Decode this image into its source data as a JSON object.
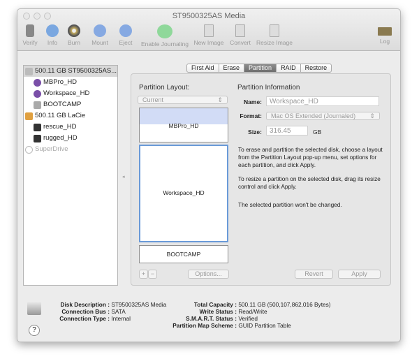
{
  "window": {
    "title": "ST9500325AS Media"
  },
  "toolbar": [
    {
      "label": "Verify",
      "icon": "microscope-icon"
    },
    {
      "label": "Info",
      "icon": "info-icon"
    },
    {
      "label": "Burn",
      "icon": "burn-icon"
    },
    {
      "label": "Mount",
      "icon": "mount-icon"
    },
    {
      "label": "Eject",
      "icon": "eject-icon"
    },
    {
      "label": "Enable Journaling",
      "icon": "journaling-icon"
    },
    {
      "label": "New Image",
      "icon": "new-image-icon"
    },
    {
      "label": "Convert",
      "icon": "convert-icon"
    },
    {
      "label": "Resize Image",
      "icon": "resize-image-icon"
    },
    {
      "label": "Log",
      "icon": "log-icon"
    }
  ],
  "sidebar": [
    {
      "label": "500.11 GB ST9500325AS...",
      "level": 0,
      "selected": true
    },
    {
      "label": "MBPro_HD",
      "level": 1
    },
    {
      "label": "Workspace_HD",
      "level": 1
    },
    {
      "label": "BOOTCAMP",
      "level": 1
    },
    {
      "label": "500.11 GB LaCie",
      "level": 0
    },
    {
      "label": "rescue_HD",
      "level": 1
    },
    {
      "label": "rugged_HD",
      "level": 1
    },
    {
      "label": "SuperDrive",
      "level": 0,
      "disabled": true
    }
  ],
  "tabs": [
    {
      "label": "First Aid"
    },
    {
      "label": "Erase"
    },
    {
      "label": "Partition",
      "active": true
    },
    {
      "label": "RAID"
    },
    {
      "label": "Restore"
    }
  ],
  "layout": {
    "heading": "Partition Layout:",
    "popup": "Current",
    "partitions": [
      "MBPro_HD",
      "Workspace_HD",
      "BOOTCAMP"
    ],
    "add": "+",
    "remove": "−",
    "options": "Options..."
  },
  "info": {
    "heading": "Partition Information",
    "name_label": "Name:",
    "name": "Workspace_HD",
    "format_label": "Format:",
    "format": "Mac OS Extended (Journaled)",
    "size_label": "Size:",
    "size": "316.45",
    "size_unit": "GB",
    "desc1": "To erase and partition the selected disk, choose a layout from the Partition Layout pop-up menu, set options for each partition, and click Apply.",
    "desc2": "To resize a partition on the selected disk, drag its resize control and click Apply.",
    "desc3": "The selected partition won't be changed.",
    "revert": "Revert",
    "apply": "Apply"
  },
  "details": {
    "left": [
      {
        "k": "Disk Description :",
        "v": "ST9500325AS Media"
      },
      {
        "k": "Connection Bus :",
        "v": "SATA"
      },
      {
        "k": "Connection Type :",
        "v": "Internal"
      }
    ],
    "right": [
      {
        "k": "Total Capacity :",
        "v": "500.11 GB (500,107,862,016 Bytes)"
      },
      {
        "k": "Write Status :",
        "v": "Read/Write"
      },
      {
        "k": "S.M.A.R.T. Status :",
        "v": "Verified"
      },
      {
        "k": "Partition Map Scheme :",
        "v": "GUID Partition Table"
      }
    ],
    "help": "?"
  }
}
